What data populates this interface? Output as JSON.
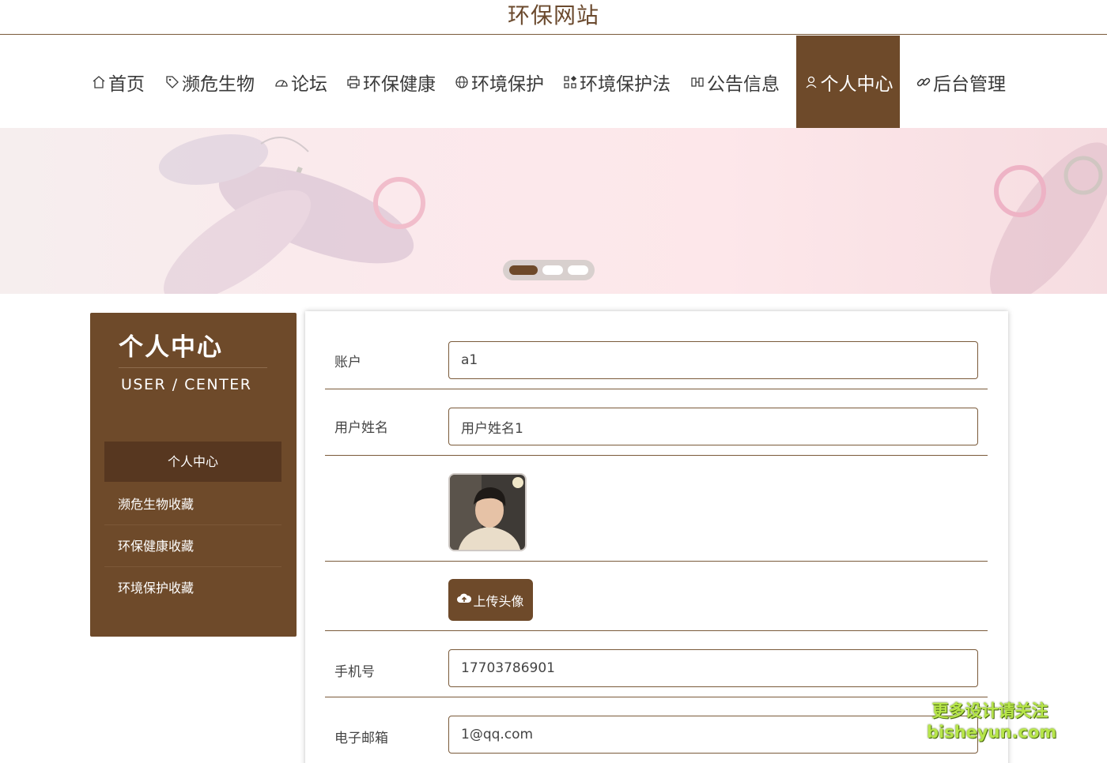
{
  "site": {
    "title": "环保网站"
  },
  "nav": [
    {
      "label": "首页",
      "icon": "home-icon"
    },
    {
      "label": "濒危生物",
      "icon": "tag-icon"
    },
    {
      "label": "论坛",
      "icon": "dashboard-icon"
    },
    {
      "label": "环保健康",
      "icon": "printer-icon"
    },
    {
      "label": "环境保护",
      "icon": "globe-icon"
    },
    {
      "label": "环境保护法",
      "icon": "apps-icon"
    },
    {
      "label": "公告信息",
      "icon": "film-icon"
    },
    {
      "label": "个人中心",
      "icon": "user-icon",
      "active": true
    },
    {
      "label": "后台管理",
      "icon": "link-icon"
    }
  ],
  "banner": {
    "slides": 3,
    "active_slide": 1
  },
  "sidebar": {
    "title": "个人中心",
    "subtitle": "USER / CENTER",
    "items": [
      {
        "label": "个人中心",
        "active": true
      },
      {
        "label": "濒危生物收藏"
      },
      {
        "label": "环保健康收藏"
      },
      {
        "label": "环境保护收藏"
      }
    ]
  },
  "form": {
    "account_label": "账户",
    "account_value": "a1",
    "name_label": "用户姓名",
    "name_value": "用户姓名1",
    "avatar_alt": "avatar",
    "upload_label": "上传头像",
    "phone_label": "手机号",
    "phone_value": "17703786901",
    "email_label": "电子邮箱",
    "email_value": "1@qq.com"
  },
  "watermark": {
    "line1": "更多设计请关注",
    "line2": "bisheyun.com"
  },
  "colors": {
    "brand": "#6e4a2a",
    "brand_dark": "#573720",
    "banner_bg": "#fbe9ec"
  }
}
